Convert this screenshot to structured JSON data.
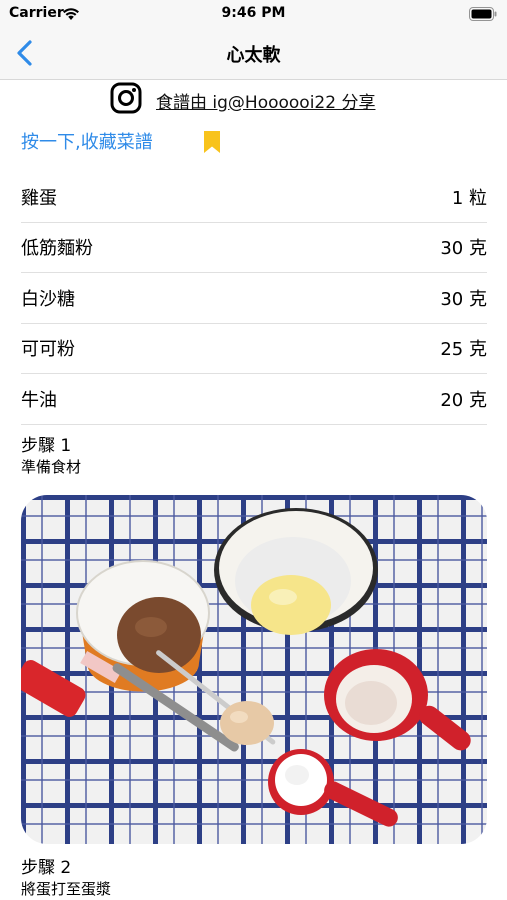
{
  "status_bar": {
    "carrier": "Carrier",
    "time": "9:46 PM"
  },
  "nav": {
    "title": "心太軟"
  },
  "credit": {
    "icon": "instagram-icon",
    "text": "食譜由 ig@Hoooooi22 分享"
  },
  "favorite": {
    "label": "按一下,收藏菜譜",
    "icon": "bookmark-icon",
    "icon_color": "#f8c31c"
  },
  "ingredients": [
    {
      "name": "雞蛋",
      "amount": "1 粒"
    },
    {
      "name": "低筋麵粉",
      "amount": "30 克"
    },
    {
      "name": "白沙糖",
      "amount": "30 克"
    },
    {
      "name": "可可粉",
      "amount": "25 克"
    },
    {
      "name": "牛油",
      "amount": "20 克"
    }
  ],
  "steps": [
    {
      "title": "步驟 1",
      "description": "準備食材"
    },
    {
      "title": "步驟 2",
      "description": "將蛋打至蛋漿"
    }
  ],
  "colors": {
    "link_blue": "#2f8be8",
    "nav_background": "#f7f7f7"
  }
}
